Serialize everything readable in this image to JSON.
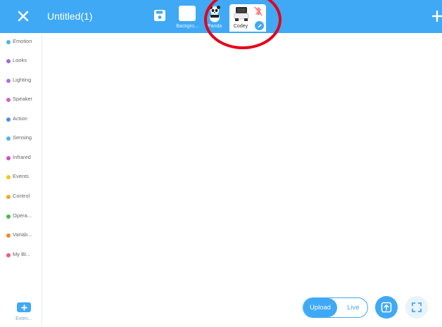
{
  "project": {
    "title": "Untitled(1)"
  },
  "sprites": [
    {
      "label": "Backgro..."
    },
    {
      "label": "Panda"
    },
    {
      "label": "Codey"
    }
  ],
  "categories": [
    {
      "label": "Emotion",
      "color": "#4fb3e8"
    },
    {
      "label": "Looks",
      "color": "#9b6dd6"
    },
    {
      "label": "Lighting",
      "color": "#b56fd8"
    },
    {
      "label": "Speaker",
      "color": "#d060c9"
    },
    {
      "label": "Action",
      "color": "#4a90e2"
    },
    {
      "label": "Sensing",
      "color": "#4fb3e8"
    },
    {
      "label": "Infrared",
      "color": "#d24dc1"
    },
    {
      "label": "Events",
      "color": "#f5c518"
    },
    {
      "label": "Control",
      "color": "#f5a623"
    },
    {
      "label": "Opera...",
      "color": "#49b84a"
    },
    {
      "label": "Variab...",
      "color": "#f0882e"
    },
    {
      "label": "My Bl...",
      "color": "#ef5a8a"
    }
  ],
  "extensions": {
    "label": "Exten..."
  },
  "mode": {
    "upload_label": "Upload",
    "live_label": "Live",
    "selected": "Upload"
  },
  "colors": {
    "accent": "#3fa9f5",
    "annotation": "#e3001b"
  },
  "icons": {
    "close": "close-icon",
    "save": "save-icon",
    "add": "plus-icon",
    "edit": "pencil-icon",
    "bluetooth": "bluetooth-disconnected-icon",
    "upload": "upload-icon",
    "fullscreen": "fullscreen-icon"
  }
}
